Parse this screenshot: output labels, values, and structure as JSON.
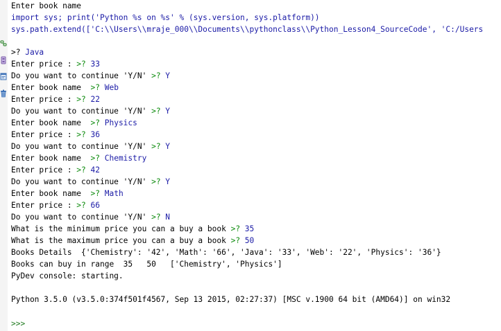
{
  "colors": {
    "input": "#1a1aa6",
    "prompt": "#0b8a0b",
    "gutter": "#f4f4f4",
    "icon_green": "#3e8e3e",
    "icon_purple": "#7b5ea7",
    "icon_blue": "#3a6fb6"
  },
  "toolbar": {
    "icons": [
      "link-icon",
      "debug-icon",
      "console-icon",
      "delete-icon"
    ]
  },
  "console": {
    "header": [
      "Enter book name",
      "import sys; print('Python %s on %s' % (sys.version, sys.platform))",
      "sys.path.extend(['C:\\\\Users\\\\mraje_000\\\\Documents\\\\pythonclass\\\\Python_Lesson4_SourceCode', 'C:/Users"
    ],
    "session": [
      {
        "t": ">? ",
        "v": "Java"
      },
      {
        "t": "Enter price : ",
        "p": ">? ",
        "v": "33"
      },
      {
        "t": "Do you want to continue 'Y/N' ",
        "p": ">? ",
        "v": "Y"
      },
      {
        "t": "Enter book name  ",
        "p": ">? ",
        "v": "Web"
      },
      {
        "t": "Enter price : ",
        "p": ">? ",
        "v": "22"
      },
      {
        "t": "Do you want to continue 'Y/N' ",
        "p": ">? ",
        "v": "Y"
      },
      {
        "t": "Enter book name  ",
        "p": ">? ",
        "v": "Physics"
      },
      {
        "t": "Enter price : ",
        "p": ">? ",
        "v": "36"
      },
      {
        "t": "Do you want to continue 'Y/N' ",
        "p": ">? ",
        "v": "Y"
      },
      {
        "t": "Enter book name  ",
        "p": ">? ",
        "v": "Chemistry"
      },
      {
        "t": "Enter price : ",
        "p": ">? ",
        "v": "42"
      },
      {
        "t": "Do you want to continue 'Y/N' ",
        "p": ">? ",
        "v": "Y"
      },
      {
        "t": "Enter book name  ",
        "p": ">? ",
        "v": "Math"
      },
      {
        "t": "Enter price : ",
        "p": ">? ",
        "v": "66"
      },
      {
        "t": "Do you want to continue 'Y/N' ",
        "p": ">? ",
        "v": "N"
      },
      {
        "t": "What is the minimum price you can a buy a book ",
        "p": ">? ",
        "v": "35"
      },
      {
        "t": "What is the maximum price you can a buy a book ",
        "p": ">? ",
        "v": "50"
      },
      {
        "t": "Books Details  {'Chemistry': '42', 'Math': '66', 'Java': '33', 'Web': '22', 'Physics': '36'}"
      },
      {
        "t": "Books can buy in range  35   50   ['Chemistry', 'Physics']"
      },
      {
        "t": "PyDev console: starting."
      },
      {
        "t": ""
      },
      {
        "t": "Python 3.5.0 (v3.5.0:374f501f4567, Sep 13 2015, 02:27:37) [MSC v.1900 64 bit (AMD64)] on win32"
      }
    ],
    "prompt": ">>>"
  }
}
